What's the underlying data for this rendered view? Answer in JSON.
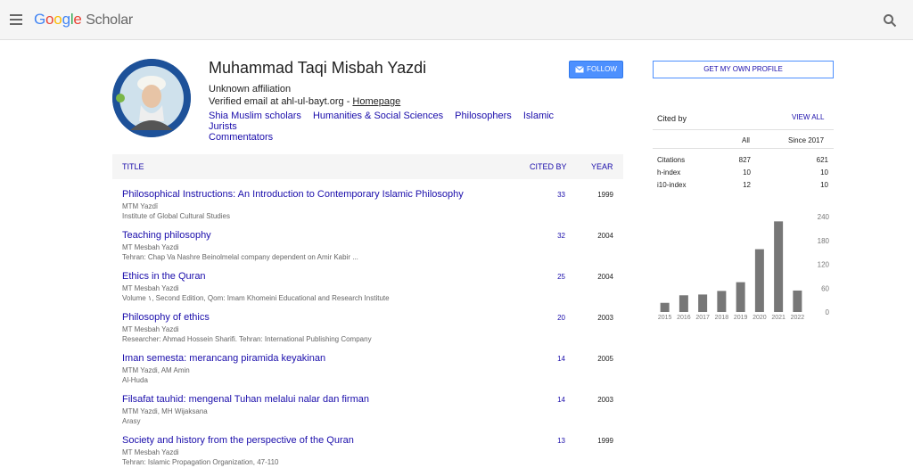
{
  "header": {
    "logo_google": "Google",
    "logo_scholar": "Scholar"
  },
  "profile": {
    "name": "Muhammad Taqi Misbah Yazdi",
    "affiliation": "Unknown affiliation",
    "verified_prefix": "Verified email at ahl-ul-bayt.org - ",
    "homepage_label": "Homepage",
    "interests": [
      "Shia Muslim scholars",
      "Humanities & Social Sciences",
      "Philosophers",
      "Islamic Jurists",
      "Commentators"
    ],
    "follow_label": "FOLLOW"
  },
  "table": {
    "col_title": "TITLE",
    "col_cited": "CITED BY",
    "col_year": "YEAR",
    "rows": [
      {
        "title": "Philosophical Instructions: An Introduction to Contemporary Islamic Philosophy",
        "authors": "MTM Yazdī",
        "venue": "Institute of Global Cultural Studies",
        "cited": "33",
        "year": "1999"
      },
      {
        "title": "Teaching philosophy",
        "authors": "MT Mesbah Yazdi",
        "venue": "Tehran: Chap Va Nashre Beinolmelal company dependent on Amir Kabir ...",
        "cited": "32",
        "year": "2004"
      },
      {
        "title": "Ethics in the Quran",
        "authors": "MT Mesbah Yazdi",
        "venue": "Volume ۱, Second Edition, Qom: Imam Khomeini Educational and Research Institute",
        "cited": "25",
        "year": "2004"
      },
      {
        "title": "Philosophy of ethics",
        "authors": "MT Mesbah Yazdi",
        "venue": "Researcher: Ahmad Hossein Sharifi. Tehran: International Publishing Company",
        "cited": "20",
        "year": "2003"
      },
      {
        "title": "Iman semesta: merancang piramida keyakinan",
        "authors": "MTM Yazdi, AM Amin",
        "venue": "Al-Huda",
        "cited": "14",
        "year": "2005"
      },
      {
        "title": "Filsafat tauhid: mengenal Tuhan melalui nalar dan firman",
        "authors": "MTM Yazdi, MH Wijaksana",
        "venue": "Arasy",
        "cited": "14",
        "year": "2003"
      },
      {
        "title": "Society and history from the perspective of the Quran",
        "authors": "MT Mesbah Yazdi",
        "venue": "Tehran: Islamic Propagation Organization, 47-110",
        "cited": "13",
        "year": "1999"
      }
    ]
  },
  "sidebar": {
    "get_profile_label": "GET MY OWN PROFILE",
    "cited_by_label": "Cited by",
    "view_all_label": "VIEW ALL",
    "col_all": "All",
    "col_since": "Since 2017",
    "stats": [
      {
        "label": "Citations",
        "all": "827",
        "since": "621"
      },
      {
        "label": "h-index",
        "all": "10",
        "since": "10"
      },
      {
        "label": "i10-index",
        "all": "12",
        "since": "10"
      }
    ]
  },
  "chart_data": {
    "type": "bar",
    "categories": [
      "2015",
      "2016",
      "2017",
      "2018",
      "2019",
      "2020",
      "2021",
      "2022"
    ],
    "values": [
      23,
      42,
      44,
      53,
      75,
      158,
      228,
      54
    ],
    "ylim": [
      0,
      240
    ],
    "yticks": [
      0,
      60,
      120,
      180,
      240
    ],
    "bar_color": "#777777"
  },
  "colors": {
    "link": "#1a0dab",
    "accent": "#4d90fe"
  }
}
